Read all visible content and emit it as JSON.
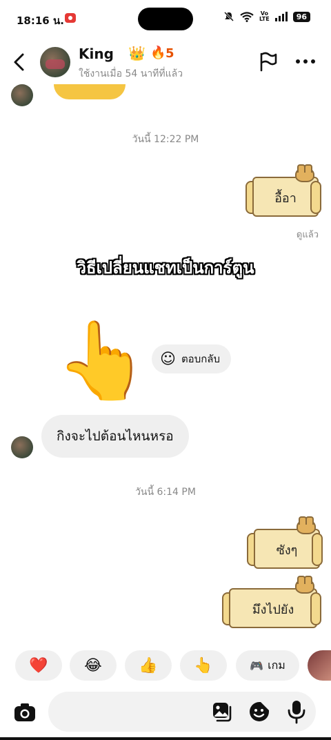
{
  "status_bar": {
    "time": "18:16 น.",
    "battery": "96",
    "volte_top": "Vo",
    "volte_bottom": "LTE"
  },
  "header": {
    "name": "King",
    "crown_emoji": "👑",
    "fire_emoji": "🔥",
    "streak": "5",
    "last_seen": "ใช้งานเมื่อ 54 นาทีที่แล้ว",
    "back_glyph": "‹",
    "more_glyph": "•••"
  },
  "chat": {
    "timestamps": [
      "วันนี้ 12:22 PM",
      "วันนี้ 6:14 PM"
    ],
    "seen_label": "ดูแล้ว",
    "overlay_caption": "วิธีเปลี่ยนแชทเป็นการ์ตูน",
    "stickers": [
      "อื้อา",
      "ซังๆ",
      "มึงไปยัง"
    ],
    "big_hand_emoji": "👆",
    "reply_pill": {
      "icon": "☺",
      "label": "ตอบกลับ"
    },
    "incoming_message": "กิงจะไปต้อนไหนหรอ"
  },
  "quick_replies": [
    {
      "emoji": "❤️"
    },
    {
      "emoji": "😂"
    },
    {
      "emoji": "👍"
    },
    {
      "emoji": "👆"
    },
    {
      "emoji": "🎮",
      "label": "เกม"
    }
  ],
  "composer": {
    "placeholder": ""
  }
}
